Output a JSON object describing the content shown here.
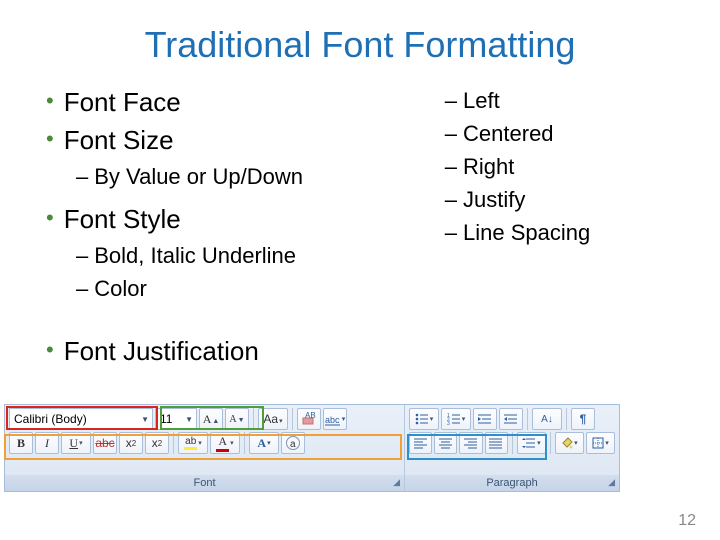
{
  "title": "Traditional Font Formatting",
  "left": {
    "font_face": "Font Face",
    "font_size": "Font Size",
    "size_sub": "By Value or Up/Down",
    "font_style": "Font Style",
    "style_sub1": "Bold, Italic Underline",
    "style_sub2": "Color",
    "font_just": "Font Justification"
  },
  "right": {
    "left": "Left",
    "centered": "Centered",
    "rightj": "Right",
    "justify": "Justify",
    "linesp": "Line Spacing"
  },
  "ribbon": {
    "font_name": "Calibri (Body)",
    "font_size": "11",
    "group_font": "Font",
    "group_para": "Paragraph"
  },
  "page": "12"
}
